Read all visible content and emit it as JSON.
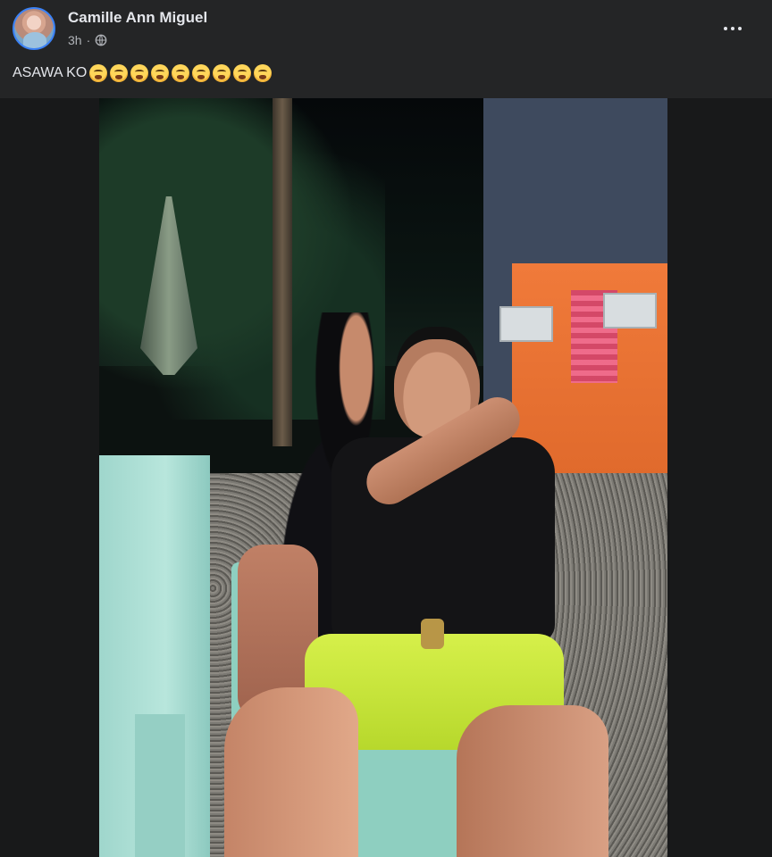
{
  "post": {
    "author": "Camille Ann Miguel",
    "timestamp": "3h",
    "audience_icon": "globe-icon",
    "caption_text": "ASAWA KO",
    "caption_emoji": "crying-face-emoji",
    "caption_emoji_count": 9,
    "more_icon": "more-options-icon"
  },
  "photo": {
    "description_icon": "photo"
  },
  "colors": {
    "background": "#242526",
    "text_primary": "#e4e6eb",
    "text_secondary": "#b0b3b8",
    "avatar_ring": "#3b82f6"
  }
}
